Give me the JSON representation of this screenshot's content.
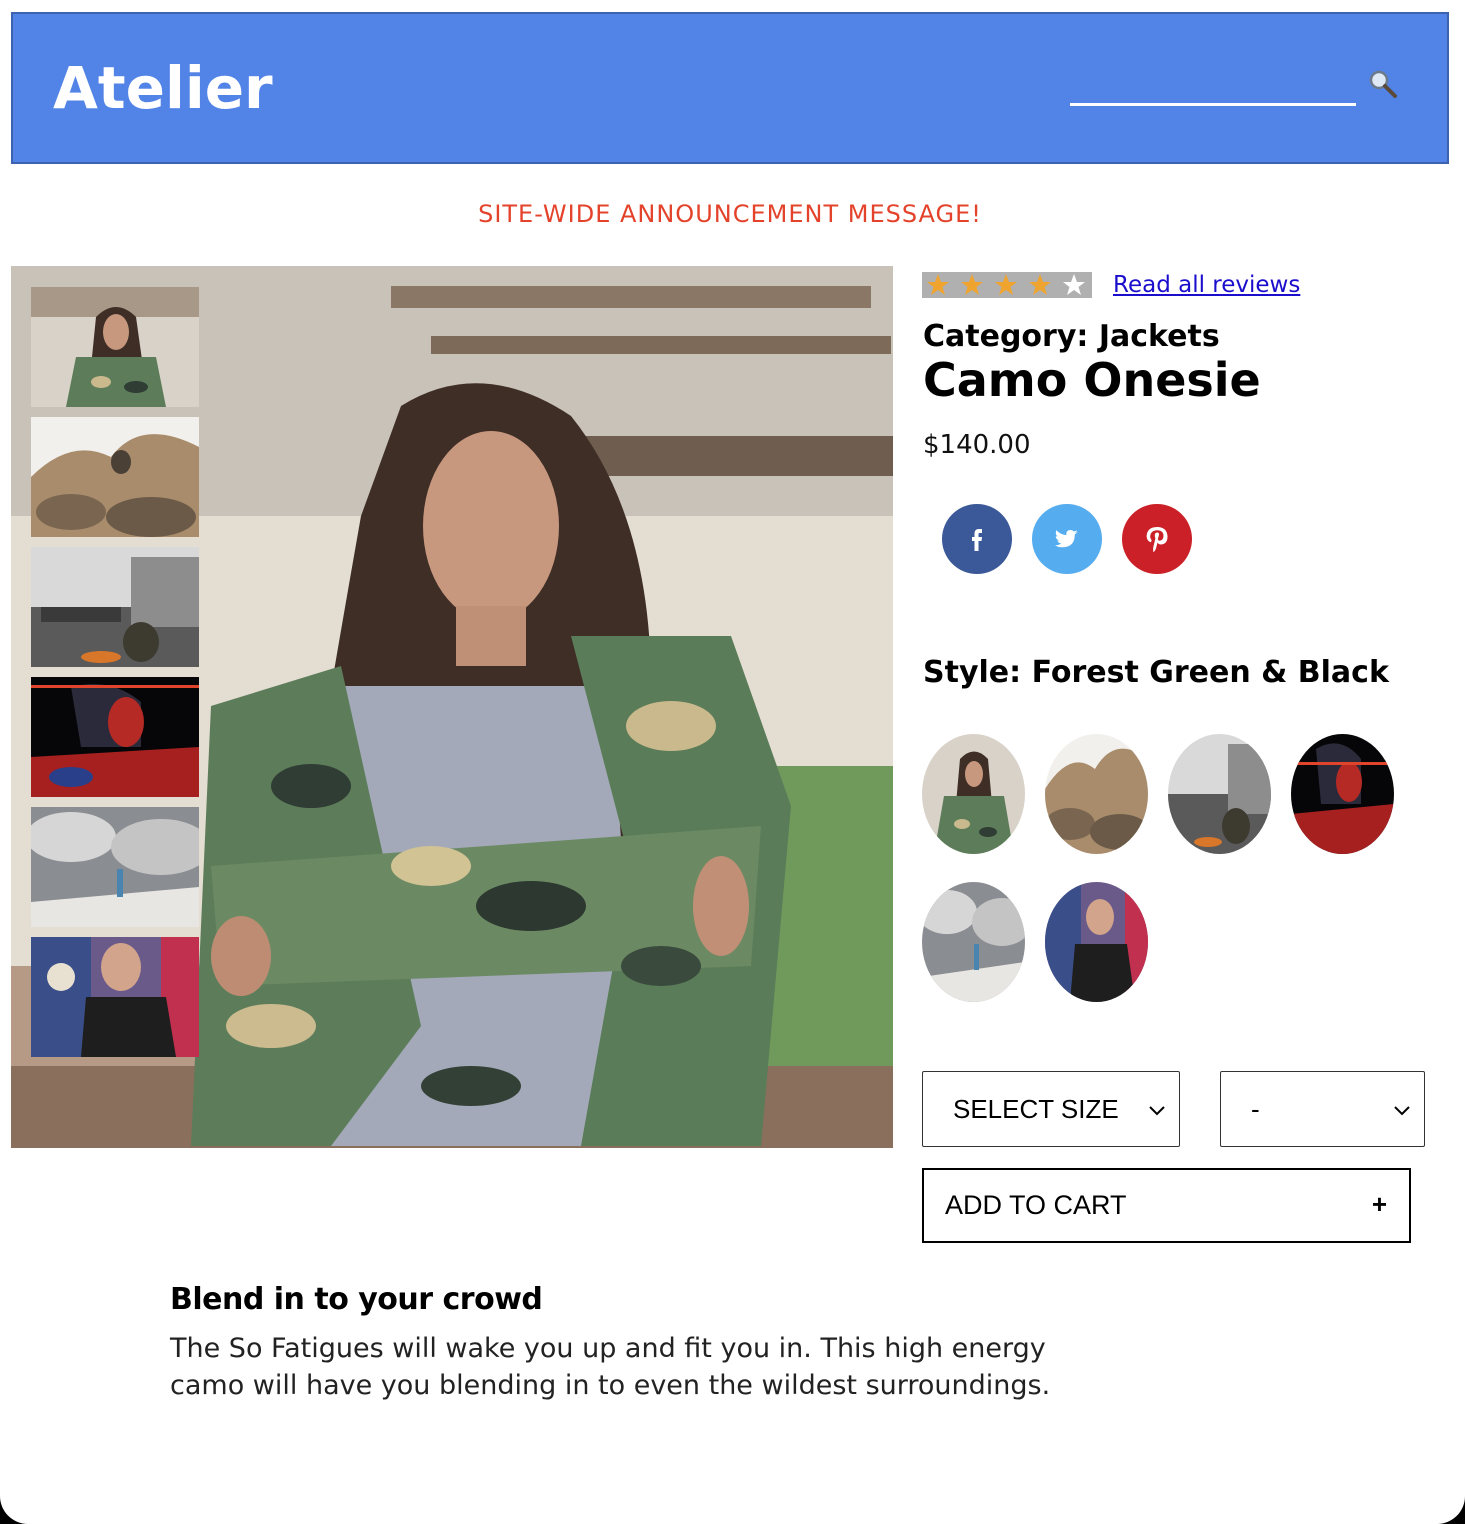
{
  "header": {
    "logo": "Atelier",
    "search_placeholder": "",
    "search_icon": "magnifier-icon"
  },
  "announcement": "SITE-WIDE ANNOUNCEMENT MESSAGE!",
  "gallery": {
    "main_image": "woman in camo jacket",
    "thumbnails": [
      "woman in camo jacket",
      "person on rocks",
      "person by ship",
      "person in red light",
      "person in snow clouds",
      "man by graffiti"
    ]
  },
  "product": {
    "rating": 4,
    "rating_max": 5,
    "reviews_link": "Read all reviews",
    "category": "Category: Jackets",
    "name": "Camo Onesie",
    "price": "$140.00",
    "social": [
      "facebook-icon",
      "twitter-icon",
      "pinterest-icon"
    ],
    "style_label": "Style: Forest Green & Black",
    "size_select": "SELECT SIZE",
    "qty_select": "-",
    "add_to_cart": "ADD TO CART",
    "add_icon": "+"
  },
  "description": {
    "title": "Blend in to your crowd",
    "text": "The So Fatigues will wake you up and fit you in. This high energy camo will have you blending in to even the wildest surroundings."
  },
  "colors": {
    "header_bg": "#5284e8",
    "announcement": "#e4432b",
    "star": "#f0a430",
    "facebook": "#3b5998",
    "twitter": "#55acee",
    "pinterest": "#cb2027"
  }
}
